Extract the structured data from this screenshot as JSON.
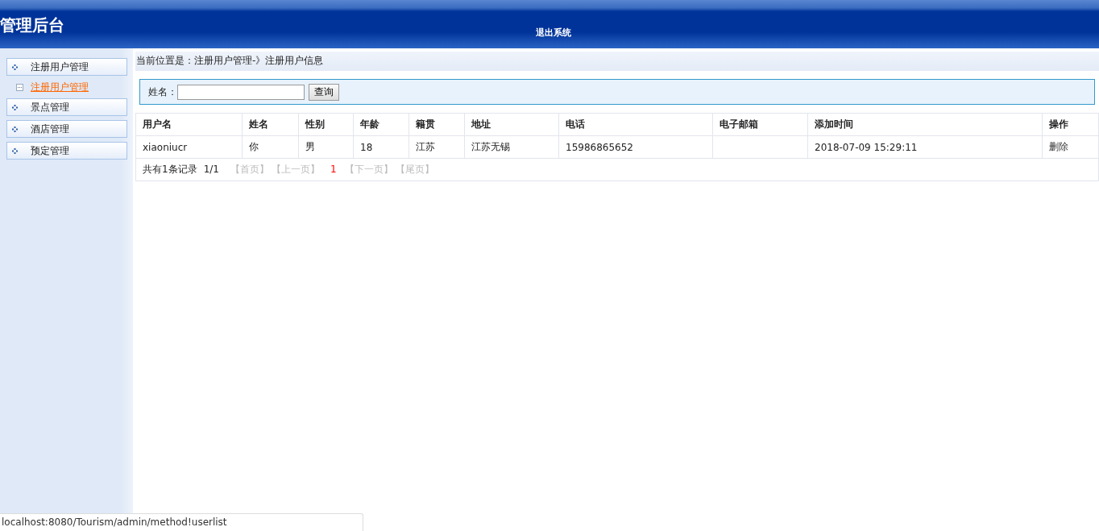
{
  "header": {
    "title": "管理后台",
    "logout": "退出系统"
  },
  "sidebar": {
    "items": [
      {
        "kind": "group",
        "label": "注册用户管理",
        "selected": false
      },
      {
        "kind": "link",
        "label": "注册用户管理",
        "selected": true
      },
      {
        "kind": "group",
        "label": "景点管理",
        "selected": false
      },
      {
        "kind": "group",
        "label": "酒店管理",
        "selected": false
      },
      {
        "kind": "group",
        "label": "预定管理",
        "selected": false
      }
    ]
  },
  "breadcrumb": "当前位置是：注册用户管理-》注册用户信息",
  "search": {
    "label": "姓名：",
    "button": "查询"
  },
  "table": {
    "columns": [
      "用户名",
      "姓名",
      "性别",
      "年龄",
      "籍贯",
      "地址",
      "电话",
      "电子邮箱",
      "添加时间",
      "操作"
    ],
    "rows": [
      {
        "cells": [
          "xiaoniucr",
          "你",
          "男",
          "18",
          "江苏",
          "江苏无锡",
          "15986865652",
          "",
          "2018-07-09 15:29:11"
        ],
        "action": "删除"
      }
    ]
  },
  "pager": {
    "summary": "共有1条记录",
    "pages": "1/1",
    "items": [
      {
        "label": "【首页】",
        "kind": "disabled"
      },
      {
        "label": "【上一页】",
        "kind": "disabled"
      },
      {
        "label": "1",
        "kind": "current"
      },
      {
        "label": "【下一页】",
        "kind": "disabled"
      },
      {
        "label": "【尾页】",
        "kind": "disabled"
      }
    ]
  },
  "status_bar": "localhost:8080/Tourism/admin/method!userlist"
}
